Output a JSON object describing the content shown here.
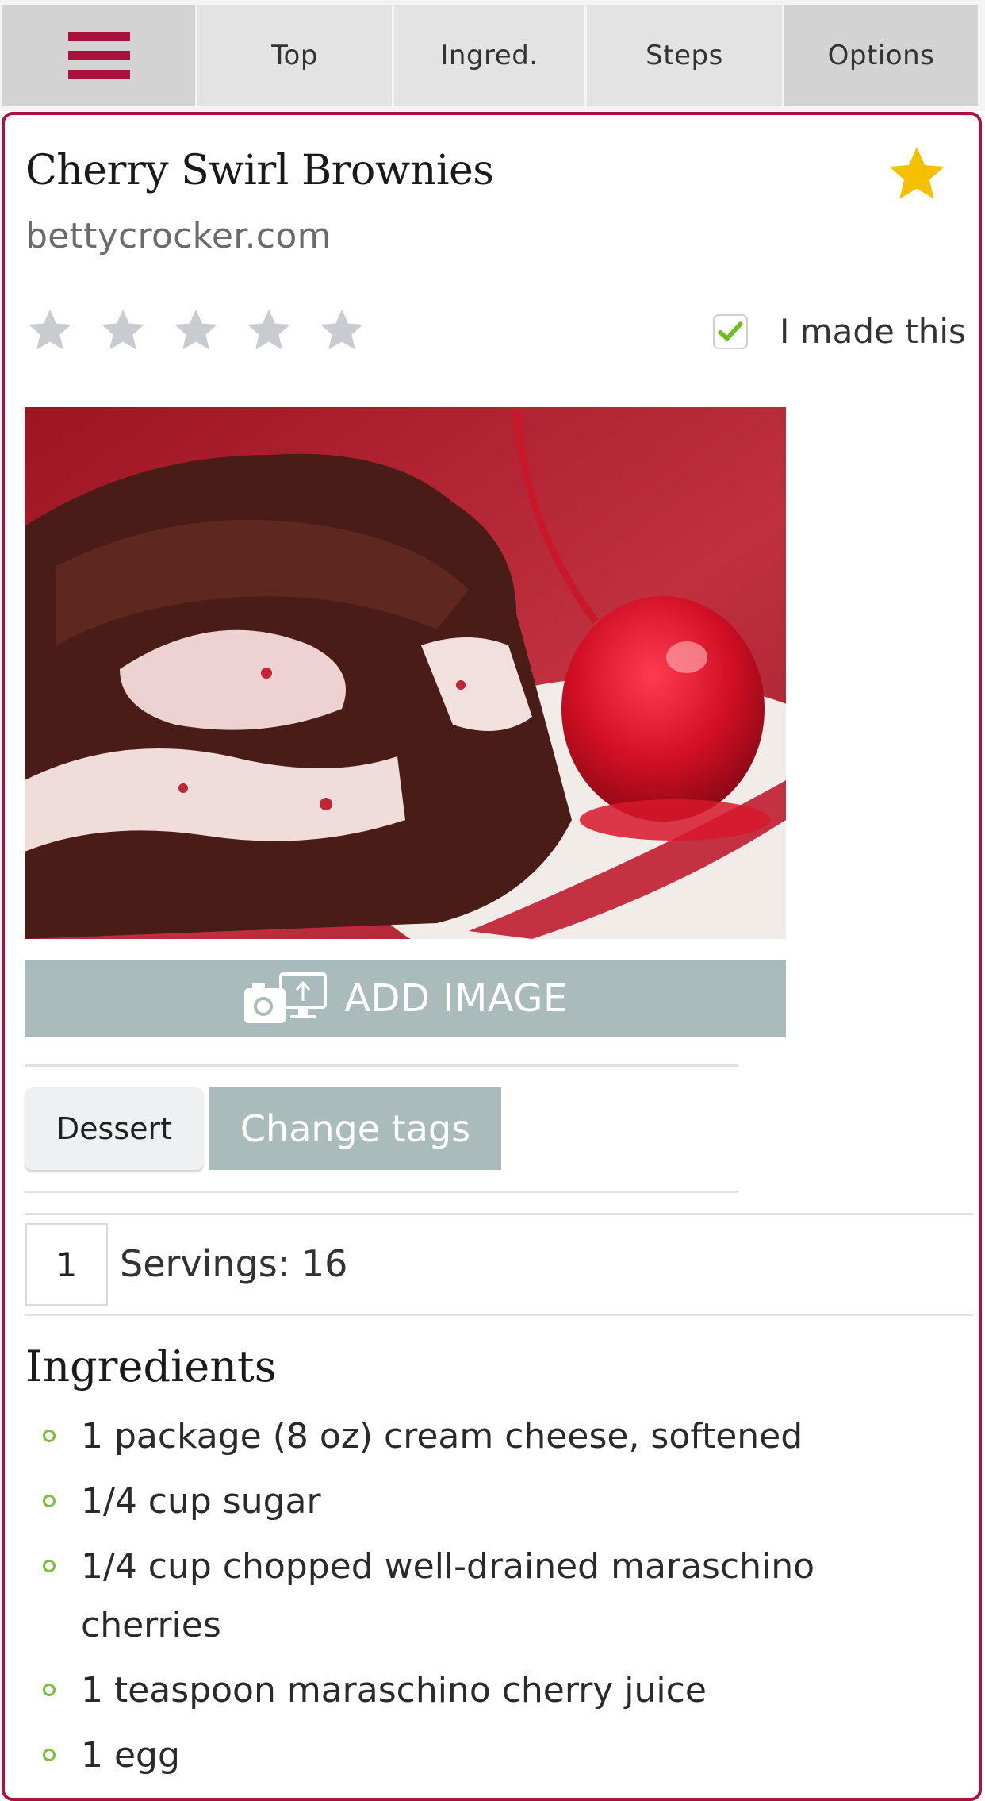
{
  "colors": {
    "accent": "#a8123d",
    "tag_button": "#a9bbbb",
    "favorite_star": "#f5c000",
    "rating_star_empty": "#c8ccd1",
    "check": "#6cbf1f",
    "bullet": "#7bbf3e"
  },
  "nav": {
    "menu_icon": "hamburger-icon",
    "tabs": [
      {
        "label": "Top"
      },
      {
        "label": "Ingred."
      },
      {
        "label": "Steps"
      },
      {
        "label": "Options"
      }
    ]
  },
  "recipe": {
    "title": "Cherry Swirl Brownies",
    "source": "bettycrocker.com",
    "favorited": true,
    "rating": {
      "value": 0,
      "max": 5
    },
    "made_this": {
      "label": "I made this",
      "checked": true
    },
    "image_alt": "Cherry swirl brownie with maraschino cherry on a plate",
    "add_image_label": "ADD IMAGE",
    "tags": [
      "Dessert"
    ],
    "change_tags_label": "Change tags",
    "servings": {
      "multiplier": "1",
      "label": "Servings: 16"
    }
  },
  "ingredients": {
    "title": "Ingredients",
    "items": [
      "1 package (8 oz) cream cheese, softened",
      "1/4 cup sugar",
      "1/4 cup chopped well-drained maraschino cherries",
      "1 teaspoon maraschino cherry juice",
      "1 egg"
    ]
  }
}
